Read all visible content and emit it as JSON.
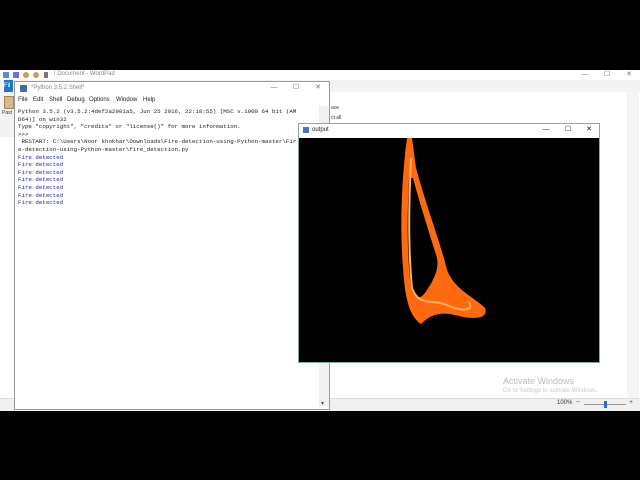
{
  "wordpad": {
    "title": "| Document - WordPad",
    "file_tab": "Fil",
    "paste_label": "Past",
    "ribbon_right_1": "ace",
    "ribbon_right_2": "ct all",
    "zoom_level": "100%",
    "zoom_minus": "−",
    "zoom_plus": "+",
    "watermark_line1": "Activate Windows",
    "watermark_line2": "Go to Settings to activate Windows."
  },
  "shell": {
    "title": "*Python 3.5.2 Shell*",
    "menus": [
      "File",
      "Edit",
      "Shell",
      "Debug",
      "Options",
      "Window",
      "Help"
    ],
    "banner_1": "Python 3.5.2 (v3.5.2:4def2a2901a5, Jun 25 2016, 22:18:55) [MSC v.1900 64 bit (AM",
    "banner_2": "D64)] on win32",
    "banner_3": "Type \"copyright\", \"credits\" or \"license()\" for more information.",
    "prompt": ">>> ",
    "restart_1": " RESTART: C:\\Users\\Noor khokhar\\Downloads\\Fire-detection-using-Python-master\\Fir",
    "restart_2": "e-detection-using-Python-master\\fire_detection.py",
    "output_lines": [
      "Fire detected",
      "Fire detected",
      "Fire detected",
      "Fire detected",
      "Fire detected",
      "Fire detected",
      "Fire detected"
    ]
  },
  "output_window": {
    "title": "output"
  },
  "window_controls": {
    "minimize": "—",
    "maximize": "☐",
    "close": "✕"
  },
  "colors": {
    "fire_orange": "#ff6a10",
    "fire_core": "#ffb060",
    "windows_blue": "#1979ca"
  }
}
